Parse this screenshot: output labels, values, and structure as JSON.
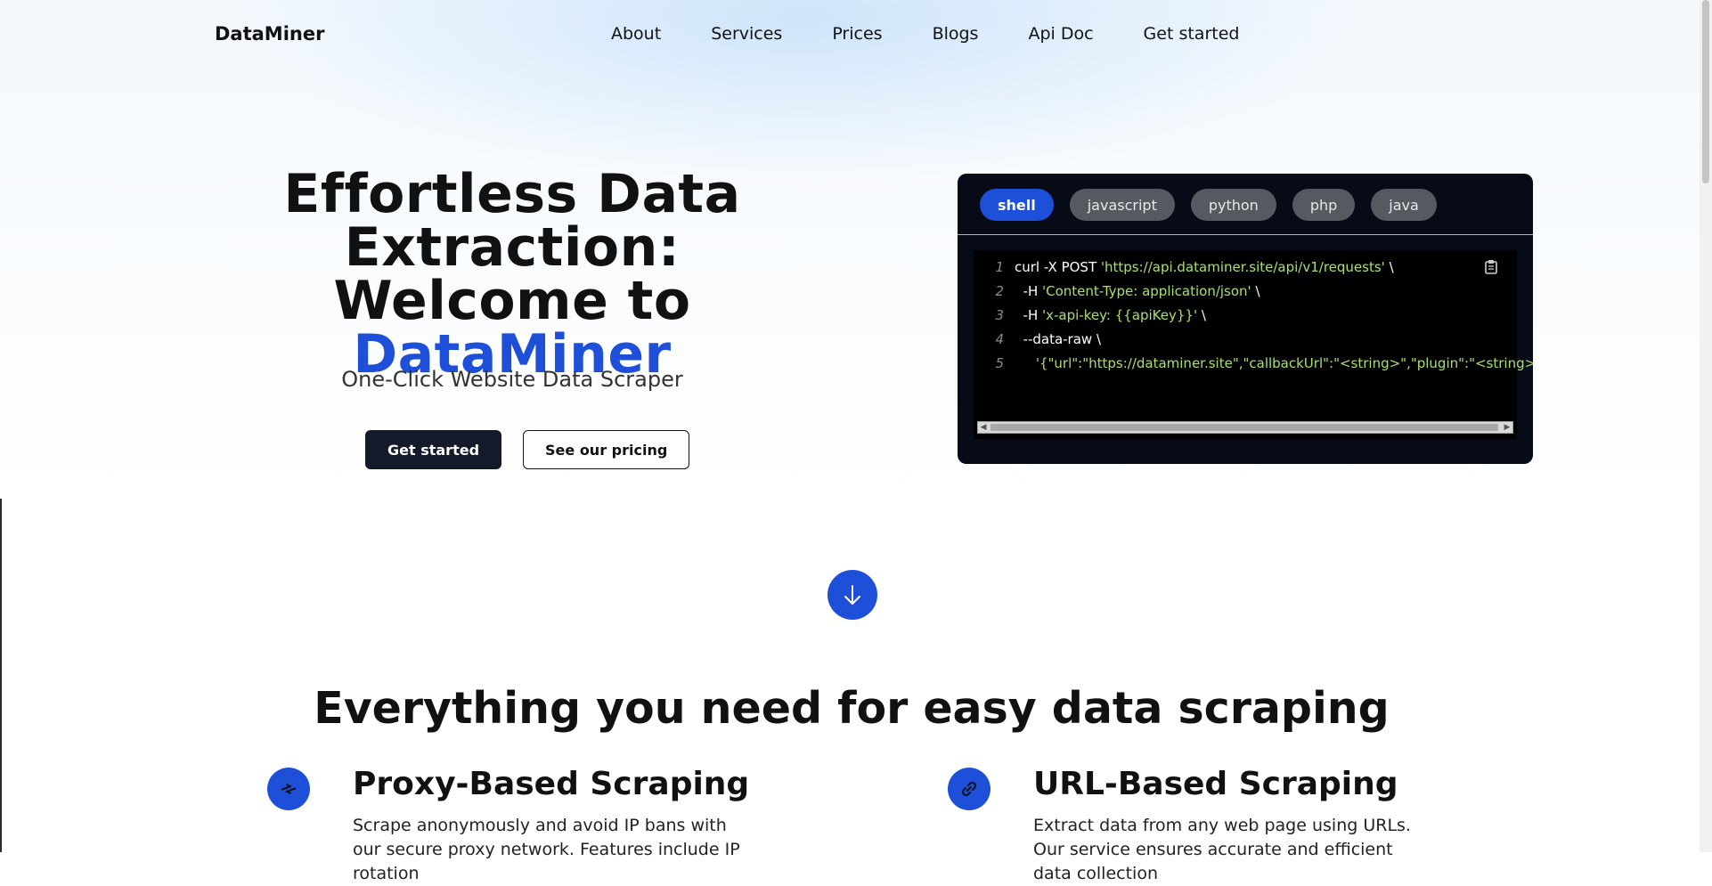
{
  "nav": {
    "brand": "DataMiner",
    "links": [
      "About",
      "Services",
      "Prices",
      "Blogs",
      "Api Doc",
      "Get started"
    ]
  },
  "hero": {
    "title_line1": "Effortless Data",
    "title_line2": "Extraction: Welcome to",
    "title_accent": "DataMiner",
    "subtitle": "One-Click Website Data Scraper",
    "primary_button": "Get started",
    "secondary_button": "See our pricing"
  },
  "code_panel": {
    "tabs": [
      "shell",
      "javascript",
      "python",
      "php",
      "java"
    ],
    "active_tab": "shell",
    "lines": [
      {
        "num": "1",
        "plain": "curl -X POST ",
        "str": "'https://api.dataminer.site/api/v1/requests'",
        "tail": " \\"
      },
      {
        "num": "2",
        "plain": "  -H ",
        "str": "'Content-Type: application/json'",
        "tail": " \\"
      },
      {
        "num": "3",
        "plain": "  -H ",
        "str": "'x-api-key: {{apiKey}}'",
        "tail": " \\"
      },
      {
        "num": "4",
        "plain": "  --data-raw \\",
        "str": "",
        "tail": ""
      },
      {
        "num": "5",
        "plain": "     ",
        "str": "'{\"url\":\"https://dataminer.site\",\"callbackUrl\":\"<string>\",\"plugin\":\"<string>\"}'",
        "tail": ""
      }
    ]
  },
  "features_section": {
    "title": "Everything you need for easy data scraping",
    "items": [
      {
        "icon": "proxy-arrows-icon",
        "title": "Proxy-Based Scraping",
        "desc": "Scrape anonymously and avoid IP bans with our secure proxy network. Features include IP rotation"
      },
      {
        "icon": "link-icon",
        "title": "URL-Based Scraping",
        "desc": "Extract data from any web page using URLs. Our service ensures accurate and efficient data collection"
      }
    ]
  },
  "colors": {
    "accent": "#1e4fd8",
    "dark_button": "#141a2a",
    "code_bg": "#070b17",
    "code_string": "#a8e06a"
  }
}
